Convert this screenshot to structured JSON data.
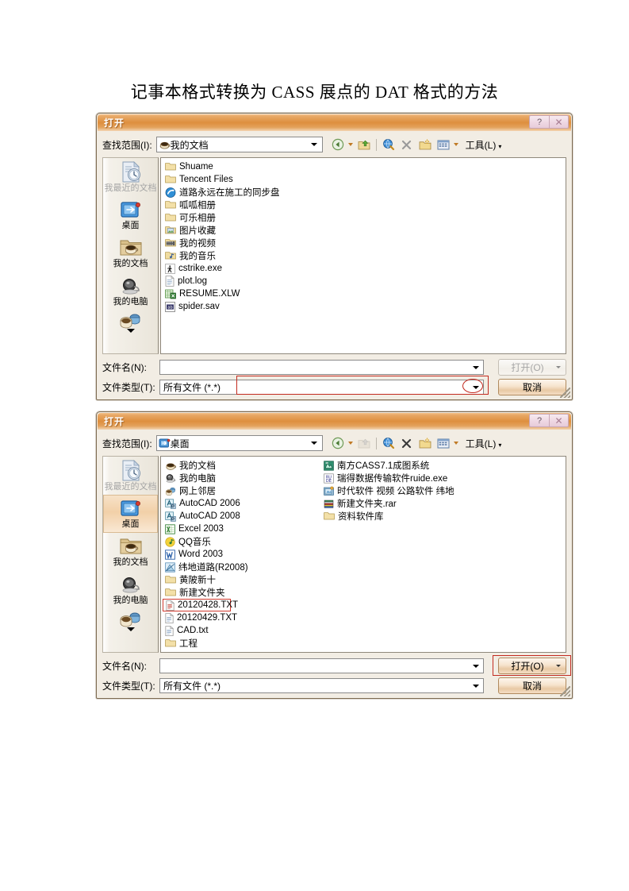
{
  "document": {
    "title": "记事本格式转换为 CASS 展点的 DAT 格式的方法"
  },
  "dialogs": [
    {
      "title": "打开",
      "titlebar_buttons": {
        "help": "?",
        "close": "✕"
      },
      "lookin": {
        "label": "查找范围(I):",
        "value": "我的文档",
        "icon": "mydocuments-icon"
      },
      "toolbar": {
        "back": "back-arrow-icon",
        "up": "up-folder-icon",
        "search": "search-globe-icon",
        "delete": "delete-x-icon",
        "newfolder": "new-folder-icon",
        "views": "views-icon",
        "tools_label": "工具(L)"
      },
      "places": [
        {
          "label": "我最近的文档",
          "icon": "recent-documents-icon",
          "state": "disabled"
        },
        {
          "label": "桌面",
          "icon": "desktop-icon",
          "state": "normal"
        },
        {
          "label": "我的文档",
          "icon": "mydocuments-folder-icon",
          "state": "normal"
        },
        {
          "label": "我的电脑",
          "icon": "mycomputer-icon",
          "state": "normal"
        },
        {
          "label": "",
          "icon": "network-icon",
          "state": "partial"
        }
      ],
      "files": [
        {
          "name": "Shuame",
          "icon": "folder-icon"
        },
        {
          "name": "Tencent Files",
          "icon": "folder-icon"
        },
        {
          "name": "道路永远在施工的同步盘",
          "icon": "sync-disk-icon"
        },
        {
          "name": "呱呱相册",
          "icon": "folder-icon"
        },
        {
          "name": "可乐相册",
          "icon": "folder-icon"
        },
        {
          "name": "图片收藏",
          "icon": "pictures-folder-icon"
        },
        {
          "name": "我的视频",
          "icon": "video-folder-icon"
        },
        {
          "name": "我的音乐",
          "icon": "music-folder-icon"
        },
        {
          "name": "cstrike.exe",
          "icon": "cstrike-icon"
        },
        {
          "name": "plot.log",
          "icon": "log-file-icon"
        },
        {
          "name": "RESUME.XLW",
          "icon": "excel-file-icon"
        },
        {
          "name": "spider.sav",
          "icon": "sav-file-icon"
        }
      ],
      "filename": {
        "label": "文件名(N):",
        "value": ""
      },
      "filetype": {
        "label": "文件类型(T):",
        "value": "所有文件 (*.*)"
      },
      "buttons": {
        "open": "打开(O)",
        "cancel": "取消",
        "open_enabled": false
      },
      "annotations": [
        {
          "shape": "rect",
          "target": "filetype-combo"
        },
        {
          "shape": "ellipse",
          "target": "filetype-dropdown-arrow"
        }
      ]
    },
    {
      "title": "打开",
      "titlebar_buttons": {
        "help": "?",
        "close": "✕"
      },
      "lookin": {
        "label": "查找范围(I):",
        "value": "桌面",
        "icon": "desktop-icon"
      },
      "toolbar": {
        "back": "back-arrow-icon",
        "up": "up-folder-icon",
        "search": "search-globe-icon",
        "delete": "delete-x-icon",
        "newfolder": "new-folder-icon",
        "views": "views-icon",
        "tools_label": "工具(L)"
      },
      "places": [
        {
          "label": "我最近的文档",
          "icon": "recent-documents-icon",
          "state": "disabled"
        },
        {
          "label": "桌面",
          "icon": "desktop-icon",
          "state": "selected"
        },
        {
          "label": "我的文档",
          "icon": "mydocuments-folder-icon",
          "state": "normal"
        },
        {
          "label": "我的电脑",
          "icon": "mycomputer-icon",
          "state": "normal"
        },
        {
          "label": "",
          "icon": "network-icon",
          "state": "partial"
        }
      ],
      "files": [
        {
          "name": "我的文档",
          "icon": "mydocuments-icon"
        },
        {
          "name": "我的电脑",
          "icon": "mycomputer-icon"
        },
        {
          "name": "网上邻居",
          "icon": "network-icon"
        },
        {
          "name": "AutoCAD 2006",
          "icon": "autocad-icon"
        },
        {
          "name": "AutoCAD 2008",
          "icon": "autocad-icon"
        },
        {
          "name": "Excel 2003",
          "icon": "excel-icon"
        },
        {
          "name": "QQ音乐",
          "icon": "qqmusic-icon"
        },
        {
          "name": "Word 2003",
          "icon": "word-icon"
        },
        {
          "name": "纬地道路(R2008)",
          "icon": "weidi-icon"
        },
        {
          "name": "黄陂新十",
          "icon": "folder-icon"
        },
        {
          "name": "新建文件夹",
          "icon": "folder-icon"
        },
        {
          "name": "20120428.TXT",
          "icon": "text-file-icon",
          "marked": true
        },
        {
          "name": "20120429.TXT",
          "icon": "text-file-icon"
        },
        {
          "name": "CAD.txt",
          "icon": "text-file-icon"
        },
        {
          "name": "工程",
          "icon": "folder-icon"
        },
        {
          "name": "南方CASS7.1成图系统",
          "icon": "cass-icon"
        },
        {
          "name": "瑞得数据传输软件ruide.exe",
          "icon": "ruide-icon"
        },
        {
          "name": "时代软件 视频 公路软件 纬地",
          "icon": "shidai-icon"
        },
        {
          "name": "新建文件夹.rar",
          "icon": "rar-icon"
        },
        {
          "name": "资料软件库",
          "icon": "folder-icon"
        }
      ],
      "filename": {
        "label": "文件名(N):",
        "value": ""
      },
      "filetype": {
        "label": "文件类型(T):",
        "value": "所有文件 (*.*)"
      },
      "buttons": {
        "open": "打开(O)",
        "cancel": "取消",
        "open_enabled": true
      },
      "annotations": [
        {
          "shape": "rect",
          "target": "open-button"
        },
        {
          "shape": "rect",
          "target": "file-20120428"
        }
      ]
    }
  ],
  "colors": {
    "titlebar_orange": "#de8f3e",
    "annotation_red": "#c32b20",
    "selection_highlight": "#f2d0a8",
    "dialog_face": "#f2ede4"
  }
}
